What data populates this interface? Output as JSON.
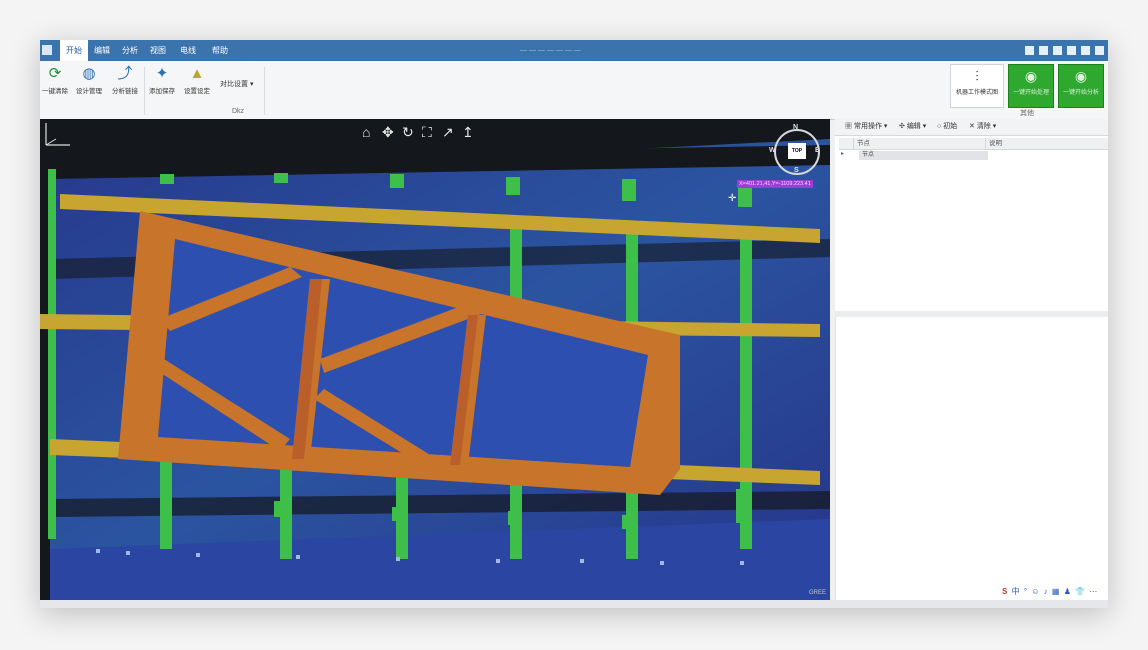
{
  "menu": {
    "tabs": [
      "开始",
      "编辑",
      "分析",
      "视图",
      "电线",
      "帮助"
    ]
  },
  "window_title": "— — — — — — —",
  "ribbon": {
    "buttons": [
      {
        "label": "一键清除",
        "icon": "refresh-icon"
      },
      {
        "label": "设计管理",
        "icon": "globe-icon"
      },
      {
        "label": "分析链接",
        "icon": "route-icon"
      },
      {
        "label": "添加保存",
        "icon": "pin-icon"
      },
      {
        "label": "设置设定",
        "icon": "chart-icon"
      }
    ],
    "dropdown_label": "对比设置",
    "group_label": "Dkz",
    "big_buttons": [
      {
        "label": "机器工作模式图",
        "icon": "circuit-icon"
      },
      {
        "label": "一键开始处理",
        "icon": "camera-icon"
      },
      {
        "label": "一键开始分析",
        "icon": "camera-icon"
      }
    ],
    "right_group_label": "其他"
  },
  "viewport": {
    "tools": [
      "⌂",
      "✥",
      "↻",
      "⛶",
      "↗",
      "↥"
    ],
    "compass": {
      "top_label": "TOP",
      "n": "N",
      "s": "S",
      "e": "E",
      "w": "W"
    },
    "coordinate": "X=401.21,41,Y=-1109.223.41",
    "scale_label": "GREE"
  },
  "panel": {
    "toolbar": [
      "常用操作",
      "编辑",
      "初始",
      "清除"
    ],
    "columns": [
      "节点",
      "说明"
    ],
    "rows": [
      {
        "name": "节点"
      }
    ]
  },
  "tray_icons": [
    "S",
    "中",
    "°",
    "☺",
    "♪",
    "▦",
    "♟",
    "👕",
    "⋯"
  ],
  "colors": {
    "accent": "#3b73ad",
    "green": "#2fa82f",
    "beam": "#c8a530",
    "truss": "#c8742a",
    "struct": "#3dbf4a",
    "floor": "#2a47a8"
  }
}
